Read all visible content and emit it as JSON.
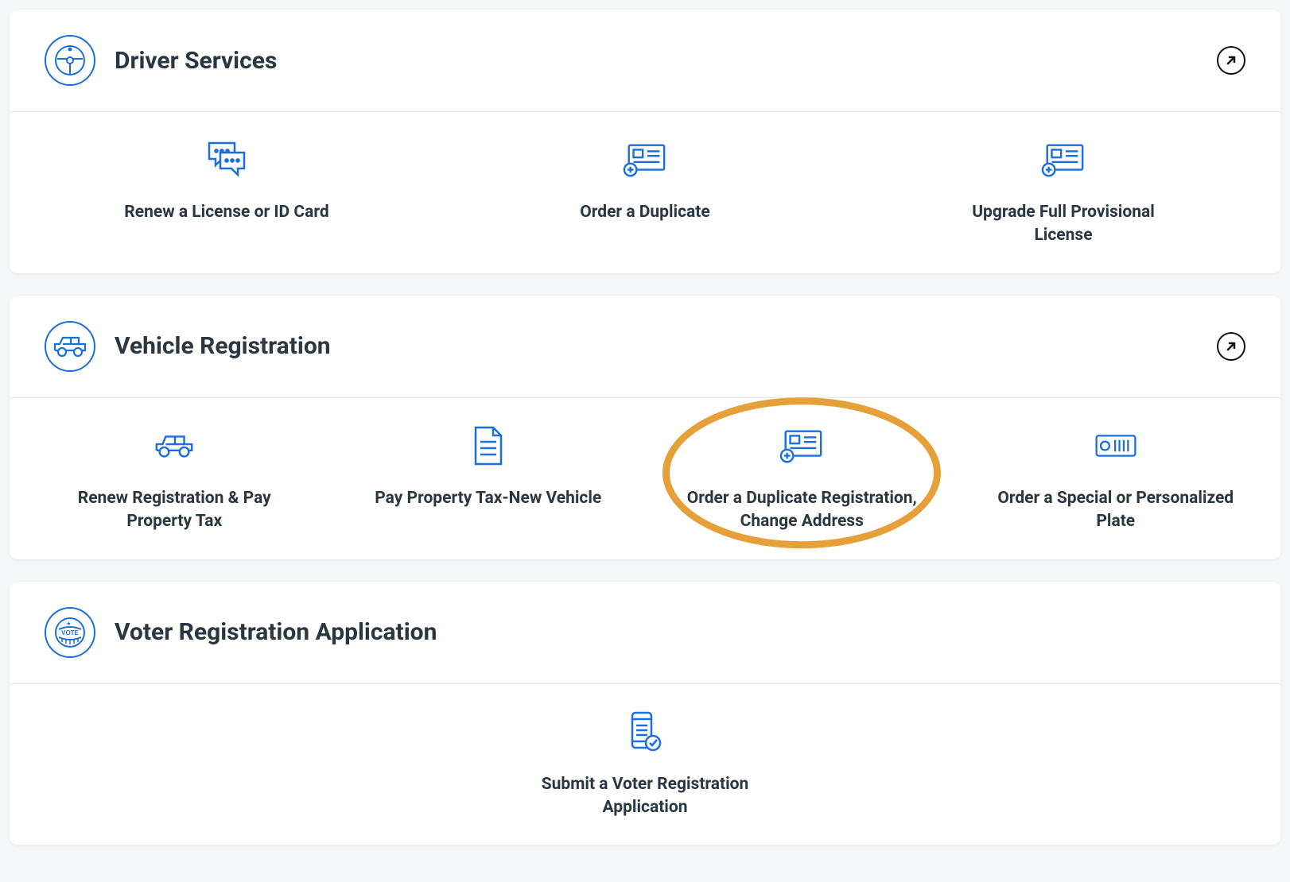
{
  "sections": [
    {
      "id": "driver",
      "title": "Driver Services",
      "icon": "steering-wheel",
      "expandable": true,
      "tiles": [
        {
          "label": "Renew a License or ID Card",
          "icon": "chat"
        },
        {
          "label": "Order a Duplicate",
          "icon": "license-add"
        },
        {
          "label": "Upgrade Full Provisional License",
          "icon": "license-add"
        }
      ]
    },
    {
      "id": "vehicle",
      "title": "Vehicle Registration",
      "icon": "vehicle",
      "expandable": true,
      "tiles": [
        {
          "label": "Renew Registration & Pay Property Tax",
          "icon": "vehicle"
        },
        {
          "label": "Pay Property Tax-New Vehicle",
          "icon": "document"
        },
        {
          "label": "Order a Duplicate Registration, Change Address",
          "icon": "license-add",
          "highlighted": true
        },
        {
          "label": "Order a Special or Personalized Plate",
          "icon": "plate"
        }
      ]
    },
    {
      "id": "voter",
      "title": "Voter Registration Application",
      "icon": "vote",
      "expandable": false,
      "tiles": [
        {
          "label": "Submit a Voter Registration Application",
          "icon": "phone-check"
        }
      ]
    }
  ]
}
